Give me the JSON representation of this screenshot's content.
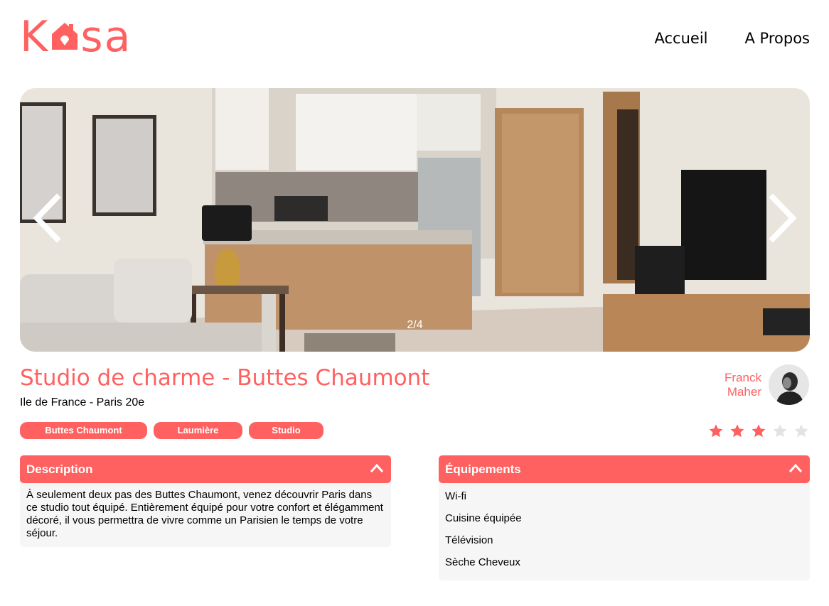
{
  "brand": {
    "logo_text": "Kasa",
    "accent_color": "#FF6060"
  },
  "nav": [
    {
      "label": "Accueil"
    },
    {
      "label": "A Propos"
    }
  ],
  "gallery": {
    "counter": "2/4",
    "prev_icon": "chevron-left-icon",
    "next_icon": "chevron-right-icon"
  },
  "listing": {
    "title": "Studio de charme - Buttes Chaumont",
    "location": "Ile de France - Paris 20e",
    "tags": [
      "Buttes Chaumont",
      "Laumière",
      "Studio"
    ],
    "host": {
      "first_name": "Franck",
      "last_name": "Maher"
    },
    "rating": 3,
    "rating_max": 5
  },
  "description": {
    "title": "Description",
    "text": "À seulement deux pas des Buttes Chaumont, venez découvrir Paris dans ce studio tout équipé. Entièrement équipé pour votre confort et élégamment décoré, il vous permettra de vivre comme un Parisien le temps de votre séjour."
  },
  "equipments": {
    "title": "Équipements",
    "items": [
      "Wi-fi",
      "Cuisine équipée",
      "Télévision",
      "Sèche Cheveux"
    ]
  }
}
